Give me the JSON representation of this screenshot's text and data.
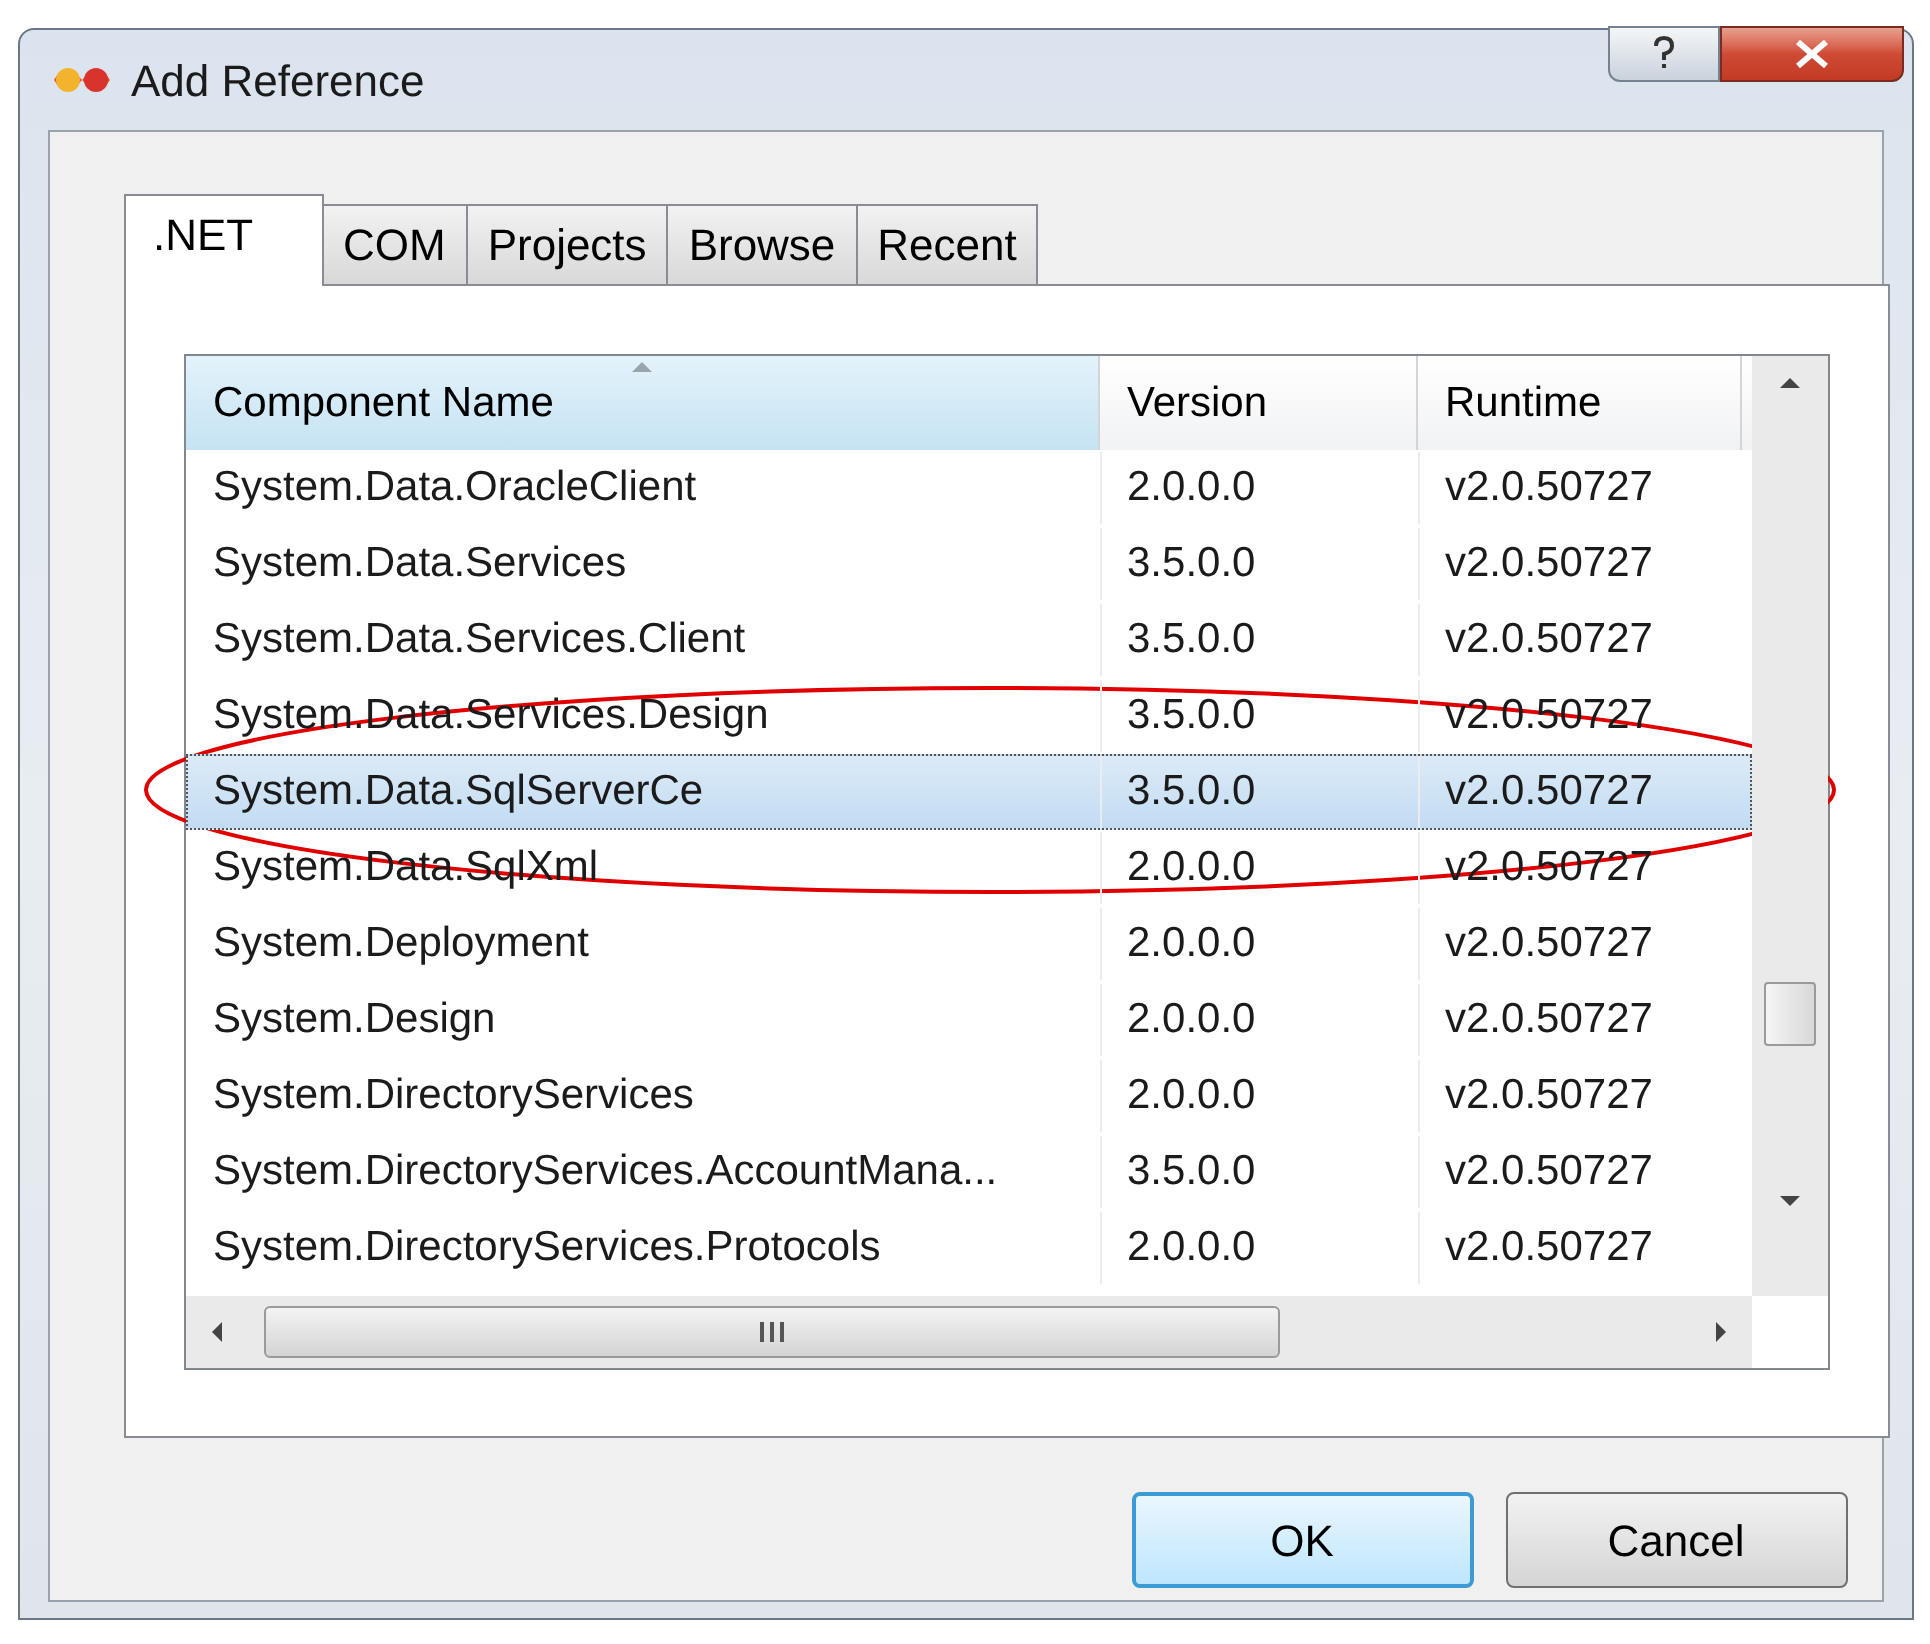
{
  "window": {
    "title": "Add Reference"
  },
  "tabs": [
    {
      "label": ".NET",
      "selected": true
    },
    {
      "label": "COM",
      "selected": false
    },
    {
      "label": "Projects",
      "selected": false
    },
    {
      "label": "Browse",
      "selected": false
    },
    {
      "label": "Recent",
      "selected": false
    }
  ],
  "table": {
    "columns": [
      {
        "label": "Component Name",
        "sorted": true
      },
      {
        "label": "Version",
        "sorted": false
      },
      {
        "label": "Runtime",
        "sorted": false
      }
    ],
    "rows": [
      {
        "cells": [
          "System.Data.OracleClient",
          "2.0.0.0",
          "v2.0.50727"
        ],
        "selected": false,
        "circled": false
      },
      {
        "cells": [
          "System.Data.Services",
          "3.5.0.0",
          "v2.0.50727"
        ],
        "selected": false,
        "circled": false
      },
      {
        "cells": [
          "System.Data.Services.Client",
          "3.5.0.0",
          "v2.0.50727"
        ],
        "selected": false,
        "circled": false
      },
      {
        "cells": [
          "System.Data.Services.Design",
          "3.5.0.0",
          "v2.0.50727"
        ],
        "selected": false,
        "circled": false
      },
      {
        "cells": [
          "System.Data.SqlServerCe",
          "3.5.0.0",
          "v2.0.50727"
        ],
        "selected": true,
        "circled": true
      },
      {
        "cells": [
          "System.Data.SqlXml",
          "2.0.0.0",
          "v2.0.50727"
        ],
        "selected": false,
        "circled": false
      },
      {
        "cells": [
          "System.Deployment",
          "2.0.0.0",
          "v2.0.50727"
        ],
        "selected": false,
        "circled": false
      },
      {
        "cells": [
          "System.Design",
          "2.0.0.0",
          "v2.0.50727"
        ],
        "selected": false,
        "circled": false
      },
      {
        "cells": [
          "System.DirectoryServices",
          "2.0.0.0",
          "v2.0.50727"
        ],
        "selected": false,
        "circled": false
      },
      {
        "cells": [
          "System.DirectoryServices.AccountMana...",
          "3.5.0.0",
          "v2.0.50727"
        ],
        "selected": false,
        "circled": false
      },
      {
        "cells": [
          "System.DirectoryServices.Protocols",
          "2.0.0.0",
          "v2.0.50727"
        ],
        "selected": false,
        "circled": false
      }
    ]
  },
  "buttons": [
    {
      "label": "OK",
      "default": true
    },
    {
      "label": "Cancel",
      "default": false
    }
  ]
}
